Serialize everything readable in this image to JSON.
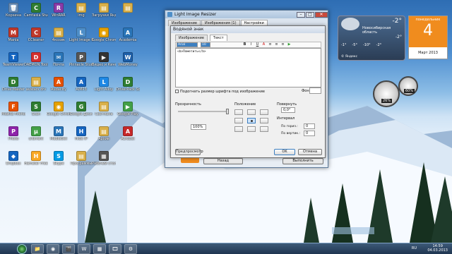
{
  "desktop": {
    "icons": [
      {
        "label": "Корзина",
        "color": "#6b8fb8",
        "glyph": "🗑"
      },
      {
        "label": "Camtasia Studio 7",
        "color": "#2f7d32",
        "glyph": "C"
      },
      {
        "label": "WinRAR",
        "color": "#8a3aa8",
        "glyph": "R"
      },
      {
        "label": "img",
        "color": "#d9b04a",
        "glyph": "▤"
      },
      {
        "label": "Загрузки Яндекс",
        "color": "#d9b04a",
        "glyph": "▤"
      },
      {
        "label": "",
        "color": "#d9b04a",
        "glyph": "▤"
      },
      {
        "label": "Mania",
        "color": "#c0392b",
        "glyph": "M"
      },
      {
        "label": "CCleaner",
        "color": "#c0392b",
        "glyph": "C"
      },
      {
        "label": "4козик",
        "color": "#d9b04a",
        "glyph": "▤"
      },
      {
        "label": "Light Image Resizer",
        "color": "#4e8ec8",
        "glyph": "L"
      },
      {
        "label": "Google Chrome",
        "color": "#e6a100",
        "glyph": "◉"
      },
      {
        "label": "Academia",
        "color": "#2a75b8",
        "glyph": "A"
      },
      {
        "label": "TeamViewer",
        "color": "#1565c0",
        "glyph": "T"
      },
      {
        "label": "DAEMON Tools Lite",
        "color": "#d32f2f",
        "glyph": "D"
      },
      {
        "label": "Почта",
        "color": "#2a75b8",
        "glyph": "✉"
      },
      {
        "label": "Pinnacle Studio",
        "color": "#555",
        "glyph": "P"
      },
      {
        "label": "Видео и Кино",
        "color": "#333",
        "glyph": "▶"
      },
      {
        "label": "WebMoney",
        "color": "#1e5fa8",
        "glyph": "W"
      },
      {
        "label": "Drive Master",
        "color": "#2e7d32",
        "glyph": "D"
      },
      {
        "label": "avatars drv",
        "color": "#d9b04a",
        "glyph": "▤"
      },
      {
        "label": "Audacity",
        "color": "#e65100",
        "glyph": "A"
      },
      {
        "label": "AIMP3",
        "color": "#1565c0",
        "glyph": "A"
      },
      {
        "label": "Light Alloy",
        "color": "#1e88e5",
        "glyph": "L"
      },
      {
        "label": "DriverPack Solution",
        "color": "#2e7d32",
        "glyph": "D"
      },
      {
        "label": "Mozilla Firefox",
        "color": "#e65100",
        "glyph": "F"
      },
      {
        "label": "Scan",
        "color": "#2e7d32",
        "glyph": "S"
      },
      {
        "label": "Google Chrome",
        "color": "#e6a100",
        "glyph": "◉"
      },
      {
        "label": "Google Диск",
        "color": "#2e7d32",
        "glyph": "G"
      },
      {
        "label": "Светлана",
        "color": "#d9b04a",
        "glyph": "▤"
      },
      {
        "label": "Google Play",
        "color": "#43a047",
        "glyph": "▶"
      },
      {
        "label": "Photo",
        "color": "#8e24aa",
        "glyph": "P"
      },
      {
        "label": "uTorrent",
        "color": "#43a047",
        "glyph": "µ"
      },
      {
        "label": "MediaGet",
        "color": "#2a75b8",
        "glyph": "M"
      },
      {
        "label": "Hide IP",
        "color": "#1565c0",
        "glyph": "H"
      },
      {
        "label": "Архив",
        "color": "#d9b04a",
        "glyph": "▤"
      },
      {
        "label": "Acrobat",
        "color": "#c62828",
        "glyph": "A"
      },
      {
        "label": "Dropbox",
        "color": "#1565c0",
        "glyph": "◆"
      },
      {
        "label": "Hamster Free",
        "color": "#f9a825",
        "glyph": "H"
      },
      {
        "label": "Skype",
        "color": "#039be5",
        "glyph": "S"
      },
      {
        "label": "Программы",
        "color": "#d9b04a",
        "glyph": "▤"
      },
      {
        "label": "Рабочий стол",
        "color": "#555",
        "glyph": "▦"
      }
    ]
  },
  "weather": {
    "temp": "-2°",
    "city": "Новосибирская область",
    "temp2": "-2°",
    "caption": "© Яндекс",
    "forecast": [
      "-1°",
      "-5°",
      "-10°",
      "-2°"
    ]
  },
  "calendar": {
    "weekday": "понедельник",
    "day": "4",
    "month": "Март 2013"
  },
  "cpu": {
    "cpu": "26%",
    "ram": "60%"
  },
  "main_window": {
    "title": "Light Image Resizer",
    "tabs": [
      "Изображение",
      "Изображения (1)",
      "Настройки"
    ],
    "bottom_btn_back": "Назад",
    "bottom_btn_run": "Выполнить"
  },
  "dialog": {
    "title": "Водяной знак",
    "tabs": [
      "Изображение",
      "Текст"
    ],
    "font_value": "Arial",
    "size_value": "10",
    "editor_text": "<b>Пометить</b>",
    "auto_size_label": "Подогнать размер шрифта под изображение",
    "color_label": "Фон:",
    "transparency_label": "Прозрачность",
    "transparency_value": "100%",
    "position_label": "Положение",
    "rotate_label": "Повернуть",
    "rotate_value": "0,0°",
    "interval_label": "Интервал",
    "horiz_label": "По гориз.:",
    "horiz_value": "0",
    "vert_label": "По вертик.:",
    "vert_value": "0",
    "preview_btn": "Предпросмотр",
    "ok_btn": "OK",
    "cancel_btn": "Отмена"
  },
  "taskbar": {
    "apps": [
      "📁",
      "◉",
      "🎬",
      "W",
      "▦",
      "🎞",
      "⚙"
    ],
    "lang": "RU",
    "time": "14:59",
    "date": "04.03.2013"
  }
}
